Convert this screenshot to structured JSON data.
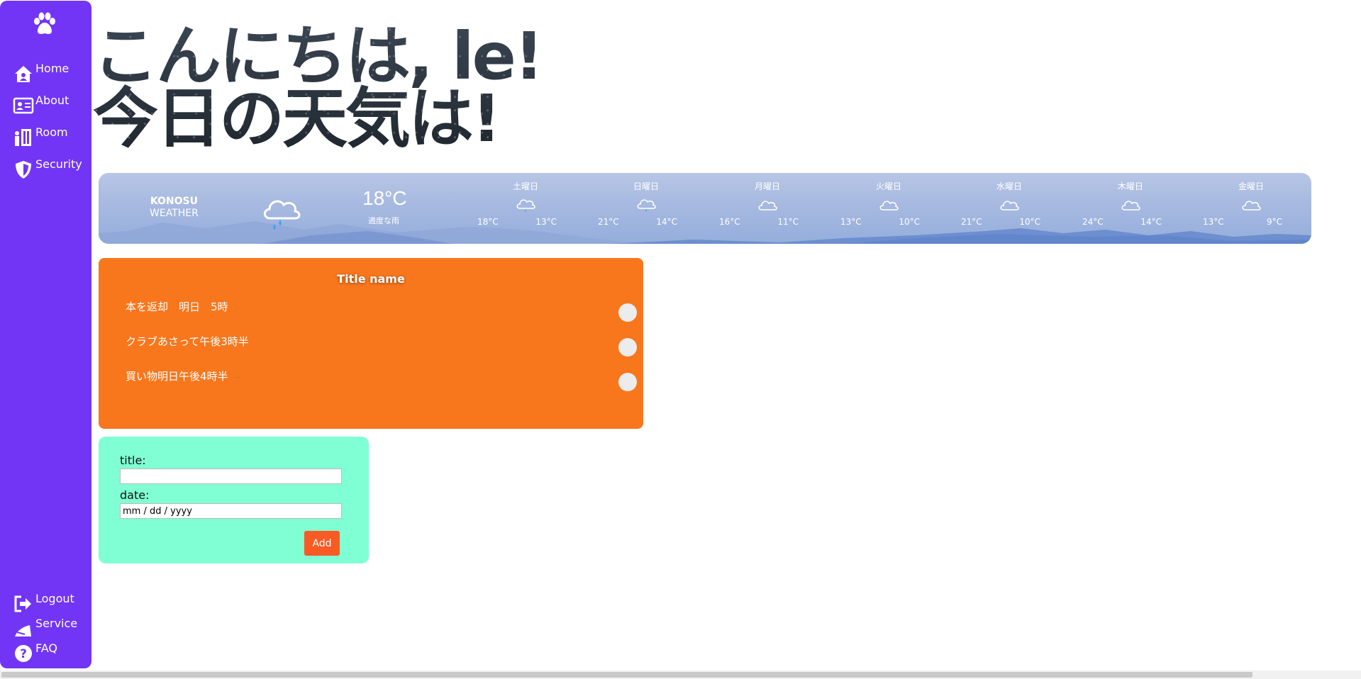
{
  "sidebar": {
    "logo_icon": "paw-icon",
    "top_items": [
      {
        "label": "Home",
        "icon": "home-icon"
      },
      {
        "label": "About",
        "icon": "id-card-icon"
      },
      {
        "label": "Room",
        "icon": "room-icon"
      },
      {
        "label": "Security",
        "icon": "shield-icon"
      }
    ],
    "bottom_items": [
      {
        "label": "Logout",
        "icon": "logout-icon"
      },
      {
        "label": "Service",
        "icon": "service-icon"
      },
      {
        "label": "FAQ",
        "icon": "question-icon"
      }
    ],
    "color": "#7235f5"
  },
  "greeting": {
    "line1": "こんにちは, le!",
    "line2": "今日の天気は!"
  },
  "weather": {
    "brand_line1": "KONOSU",
    "brand_line2": "WEATHER",
    "current_temp": "18°C",
    "current_condition": "適度な雨",
    "current_icon": "rain-cloud-icon",
    "forecast": [
      {
        "day": "土曜日",
        "icon": "rain-cloud-icon",
        "high": "18°C",
        "low": "13°C"
      },
      {
        "day": "日曜日",
        "icon": "rain-cloud-icon",
        "high": "21°C",
        "low": "14°C"
      },
      {
        "day": "月曜日",
        "icon": "cloud-icon",
        "high": "16°C",
        "low": "11°C"
      },
      {
        "day": "火曜日",
        "icon": "cloud-icon",
        "high": "13°C",
        "low": "10°C"
      },
      {
        "day": "水曜日",
        "icon": "cloud-icon",
        "high": "21°C",
        "low": "10°C"
      },
      {
        "day": "木曜日",
        "icon": "cloud-icon",
        "high": "24°C",
        "low": "14°C"
      },
      {
        "day": "金曜日",
        "icon": "cloud-icon",
        "high": "13°C",
        "low": "9°C"
      }
    ]
  },
  "todo": {
    "title": "Title name",
    "items": [
      "本を返却　明日　5時",
      "クラブあさって午後3時半",
      "買い物明日午後4時半"
    ],
    "color": "#f8771d"
  },
  "form": {
    "title_label": "title:",
    "title_value": "",
    "date_label": "date:",
    "date_placeholder": "mm / dd / yyyy",
    "add_label": "Add",
    "color": "#80ffd4",
    "button_color": "#fa5a23"
  }
}
